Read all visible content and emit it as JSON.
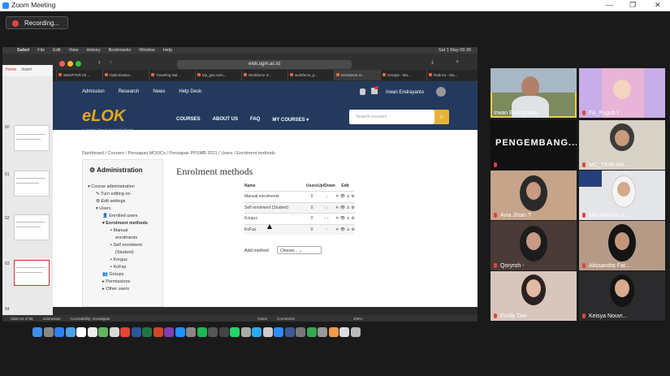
{
  "zoom": {
    "title": "Zoom Meeting",
    "recording": "Recording..."
  },
  "mac": {
    "menu": [
      "Safari",
      "File",
      "Edit",
      "View",
      "History",
      "Bookmarks",
      "Window",
      "Help"
    ],
    "clock": "Sat 1 May 09.39"
  },
  "browser": {
    "url": "elok.ugm.ac.id",
    "tabs": [
      "SMARTER 03 ...",
      "Optimization...",
      "Traveling Sal...",
      "tsp_ga1.sum...",
      "Workforce S...",
      "workforce_p...",
      "Enrolment m...",
      "Groups - Mo...",
      "Rubrics - Mo..."
    ]
  },
  "ppt": {
    "tabs": [
      "Home",
      "Insert",
      "Draw"
    ],
    "slides": [
      "60",
      "61",
      "62",
      "63",
      "64"
    ],
    "status": "Slide 63 of 65",
    "lang": "Indonesian",
    "access": "Accessibility: Investigate",
    "notes": "Notes",
    "comments": "Comments",
    "zoom": "106%"
  },
  "elok": {
    "topnav": [
      "Admission",
      "Research",
      "News",
      "Help Desk"
    ],
    "user": "Irwan Endrayanto",
    "logo": "eLOK",
    "logo_sub": "e-Learning: Open for Knowledge Sharing",
    "mainnav": [
      "COURSES",
      "ABOUT US",
      "FAQ",
      "MY COURSES ▾"
    ],
    "search_placeholder": "Search courses",
    "breadcrumb": "Dashboard / Courses / Persiapan MOOCs / Persiapan PPSMB 2021 / Users / Enrolment methods",
    "admin_title": "Administration",
    "tree": [
      "Course administration",
      "Turn editing on",
      "Edit settings",
      "Users",
      "Enrolled users",
      "Enrolment methods",
      "Manual",
      "enrolments",
      "Self enrolment",
      "(Student)",
      "Korgus",
      "KoFas",
      "Groups",
      "Permissions",
      "Other users"
    ],
    "page_title": "Enrolment methods",
    "table_headers": [
      "Name",
      "Users",
      "Up/Down",
      "Edit"
    ],
    "rows": [
      {
        "name": "Manual enrolments",
        "users": "0",
        "updown": "↓"
      },
      {
        "name": "Self enrolment (Student)",
        "users": "0",
        "updown": "↑ ↓"
      },
      {
        "name": "Korgus",
        "users": "0",
        "updown": "↑ ↓"
      },
      {
        "name": "KoFas",
        "users": "0",
        "updown": "↑"
      }
    ],
    "edit_icons": "✕ 👁 ♙ ⚙",
    "add_method_label": "Add method",
    "add_method_value": "Choose..."
  },
  "participants": [
    "Irwan Endrayanto",
    "FA_Puguh I",
    "PENGEMBANG...",
    "MC_TIUR MA...",
    "Avia Jihan T",
    "Idel Khurnia S...",
    "Qoryroh -",
    "Alissandra Fat...",
    "Emilly Dwi",
    "Keisya Nouvr..."
  ]
}
